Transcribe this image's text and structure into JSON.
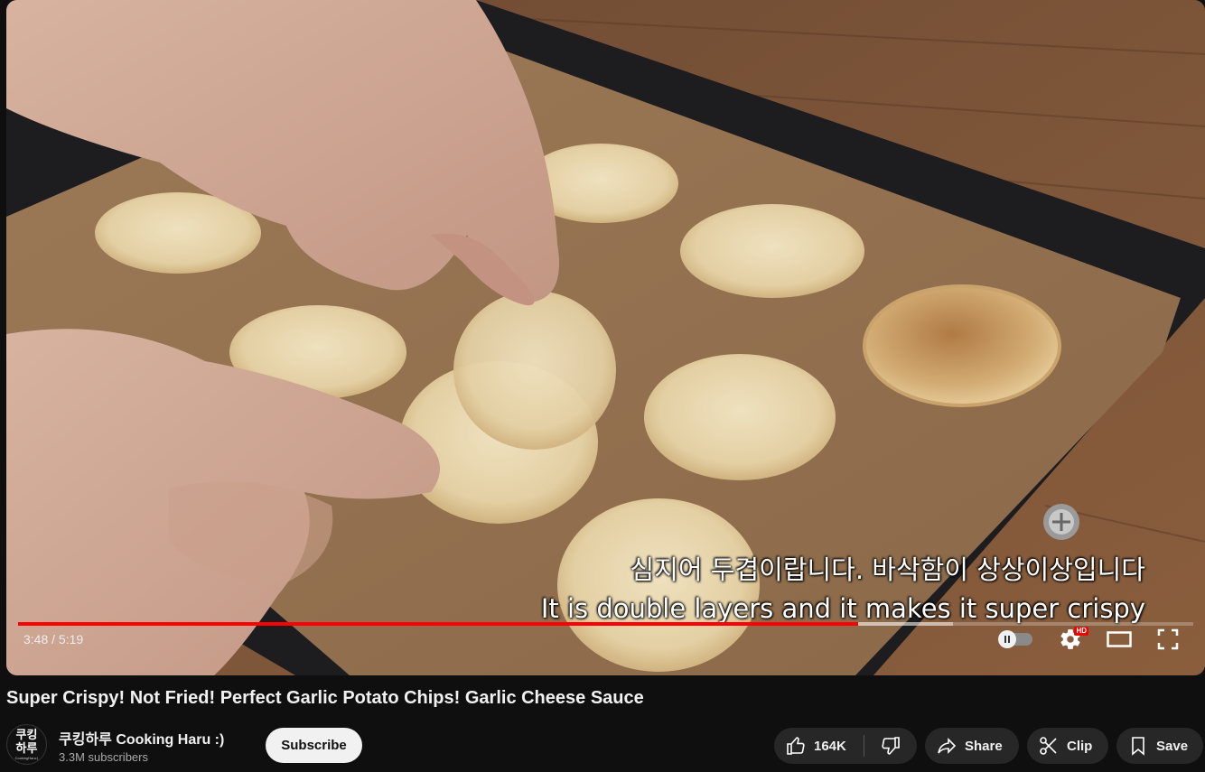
{
  "video": {
    "subtitle_korean": "심지어 두겹이랍니다. 바삭함이 상상이상입니다",
    "subtitle_english": "It is double layers and it makes it super crispy",
    "time_display": "3:48 / 5:19",
    "progress_played_fraction": 0.7145,
    "progress_buffered_fraction": 0.7955,
    "hd_badge": "HD",
    "icons": {
      "autoplay": "autoplay-toggle-icon",
      "settings": "gear-icon",
      "theater": "theater-mode-icon",
      "fullscreen": "fullscreen-icon"
    }
  },
  "title": "Super Crispy! Not Fried! Perfect Garlic Potato Chips! Garlic Cheese Sauce",
  "channel": {
    "avatar_text": "쿠킹\n하루",
    "avatar_sub": "CookingHaru:)",
    "name": "쿠킹하루 Cooking Haru :)",
    "subscribers": "3.3M subscribers",
    "subscribe_label": "Subscribe"
  },
  "actions": {
    "likes": "164K",
    "share_label": "Share",
    "clip_label": "Clip",
    "save_label": "Save"
  },
  "colors": {
    "background": "#0f0f0f",
    "progress_red": "#ff0000",
    "button_bg": "#272727",
    "subscribe_bg": "#f1f1f1"
  }
}
